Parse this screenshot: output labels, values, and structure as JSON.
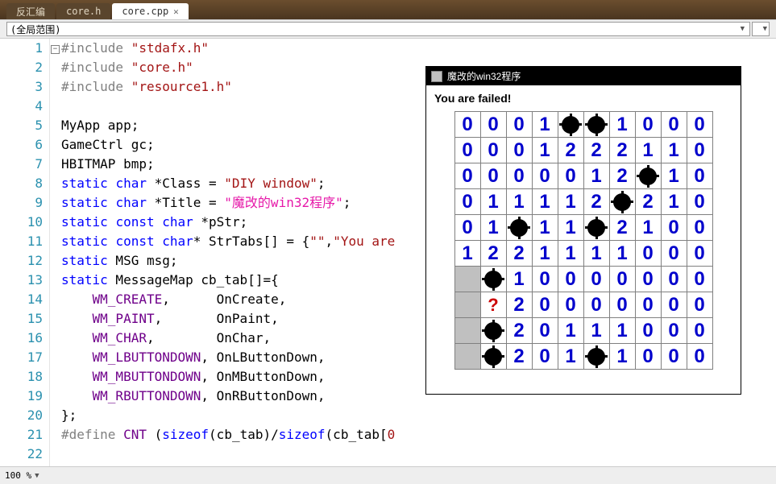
{
  "tabs": [
    {
      "label": "反汇编",
      "active": false
    },
    {
      "label": "core.h",
      "active": false
    },
    {
      "label": "core.cpp",
      "active": true
    }
  ],
  "scope": {
    "text": "(全局范围)"
  },
  "code_lines": [
    {
      "n": "1",
      "html": "<span class='pre'>#include</span> <span class='str'>\"stdafx.h\"</span>"
    },
    {
      "n": "2",
      "html": "<span class='pre'>#include</span> <span class='str'>\"core.h\"</span>"
    },
    {
      "n": "3",
      "html": "<span class='pre'>#include</span> <span class='str'>\"resource1.h\"</span>"
    },
    {
      "n": "4",
      "html": ""
    },
    {
      "n": "5",
      "html": "MyApp app;"
    },
    {
      "n": "6",
      "html": "GameCtrl gc;"
    },
    {
      "n": "7",
      "html": "HBITMAP bmp;"
    },
    {
      "n": "8",
      "html": "<span class='kw'>static</span> <span class='kw'>char</span> *Class = <span class='str'>\"DIY window\"</span>;"
    },
    {
      "n": "9",
      "html": "<span class='kw'>static</span> <span class='kw'>char</span> *Title = <span class='str-cn'>\"魔改的win32程序\"</span>;"
    },
    {
      "n": "10",
      "html": "<span class='kw'>static</span> <span class='kw'>const</span> <span class='kw'>char</span> *pStr;"
    },
    {
      "n": "11",
      "html": "<span class='kw'>static</span> <span class='kw'>const</span> <span class='kw'>char</span>* StrTabs[] = {<span class='str'>\"\"</span>,<span class='str'>\"You are</span>"
    },
    {
      "n": "12",
      "html": "<span class='kw'>static</span> MSG msg;"
    },
    {
      "n": "13",
      "html": "<span class='kw'>static</span> MessageMap cb_tab[]={"
    },
    {
      "n": "14",
      "html": "    <span class='mac'>WM_CREATE</span>,      OnCreate,"
    },
    {
      "n": "15",
      "html": "    <span class='mac'>WM_PAINT</span>,       OnPaint,"
    },
    {
      "n": "16",
      "html": "    <span class='mac'>WM_CHAR</span>,        OnChar,"
    },
    {
      "n": "17",
      "html": "    <span class='mac'>WM_LBUTTONDOWN</span>, OnLButtonDown,"
    },
    {
      "n": "18",
      "html": "    <span class='mac'>WM_MBUTTONDOWN</span>, OnMButtonDown,"
    },
    {
      "n": "19",
      "html": "    <span class='mac'>WM_RBUTTONDOWN</span>, OnRButtonDown,"
    },
    {
      "n": "20",
      "html": "};"
    },
    {
      "n": "21",
      "html": "<span class='pre'>#define</span> <span class='mac'>CNT</span> (<span class='kw'>sizeof</span>(cb_tab)/<span class='kw'>sizeof</span>(cb_tab[<span class='str'>0</span>"
    },
    {
      "n": "22",
      "html": ""
    }
  ],
  "status": {
    "zoom": "100 %"
  },
  "game": {
    "title": "魔改的win32程序",
    "status": "You are failed!",
    "grid": [
      [
        "0",
        "0",
        "0",
        "1",
        "B",
        "B",
        "1",
        "0",
        "0",
        "0"
      ],
      [
        "0",
        "0",
        "0",
        "1",
        "2",
        "2",
        "2",
        "1",
        "1",
        "0"
      ],
      [
        "0",
        "0",
        "0",
        "0",
        "0",
        "1",
        "2",
        "B",
        "1",
        "0"
      ],
      [
        "0",
        "1",
        "1",
        "1",
        "1",
        "2",
        "B",
        "2",
        "1",
        "0"
      ],
      [
        "0",
        "1",
        "B",
        "1",
        "1",
        "B",
        "2",
        "1",
        "0",
        "0"
      ],
      [
        "1",
        "2",
        "2",
        "1",
        "1",
        "1",
        "1",
        "0",
        "0",
        "0"
      ],
      [
        "",
        "B",
        "1",
        "0",
        "0",
        "0",
        "0",
        "0",
        "0",
        "0"
      ],
      [
        "",
        "?",
        "2",
        "0",
        "0",
        "0",
        "0",
        "0",
        "0",
        "0"
      ],
      [
        "",
        "B",
        "2",
        "0",
        "1",
        "1",
        "1",
        "0",
        "0",
        "0"
      ],
      [
        "",
        "B",
        "2",
        "0",
        "1",
        "B",
        "1",
        "0",
        "0",
        "0"
      ]
    ]
  }
}
